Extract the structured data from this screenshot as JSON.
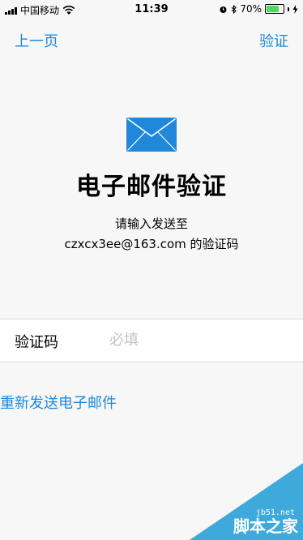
{
  "status_bar": {
    "carrier": "中国移动",
    "time": "11:39",
    "battery": "70%",
    "battery_level": 0.7
  },
  "nav": {
    "back_label": "上一页",
    "action_label": "验证"
  },
  "main": {
    "icon": "envelope-icon",
    "title": "电子邮件验证",
    "desc_line1": "请输入发送至",
    "desc_line2": "czxcx3ee@163.com 的验证码"
  },
  "code_field": {
    "label": "验证码",
    "placeholder": "必填",
    "value": ""
  },
  "resend_label": "重新发送电子邮件",
  "watermark": {
    "site": "jb51.net",
    "logo": "脚本之家"
  },
  "colors": {
    "accent": "#1f88d9",
    "battery": "#4cd964",
    "background": "#f7f7f7",
    "watermark": "#3fa9dc"
  }
}
